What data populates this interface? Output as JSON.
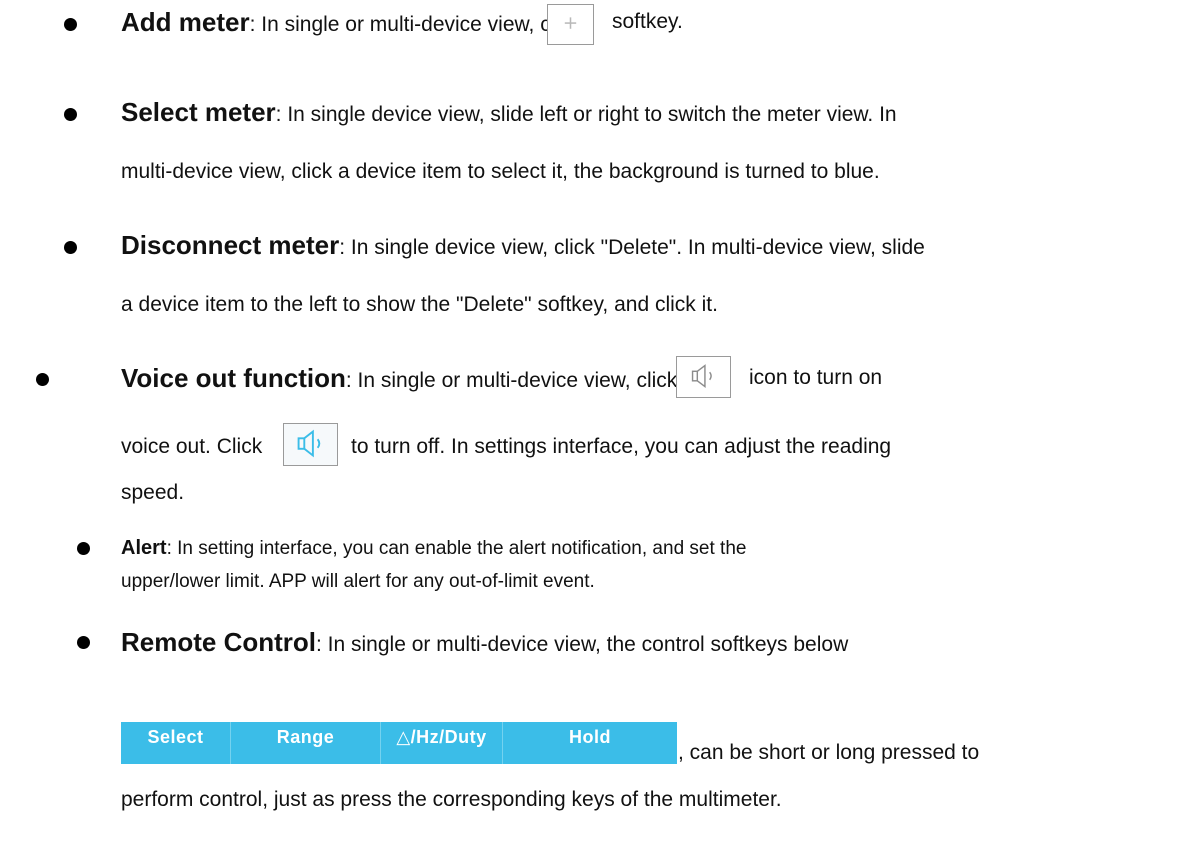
{
  "items": [
    {
      "term": "Add meter",
      "before_icon": ": In single or multi-device view, click",
      "after_icon": "softkey.",
      "icon": "plus-icon"
    },
    {
      "term": "Select meter",
      "line1": ": In single device view, slide left or right to switch the meter view. In",
      "line2": "multi-device view, click a device item to select it, the background is turned to blue."
    },
    {
      "term": "Disconnect meter",
      "line1": ": In single device view, click \"Delete\". In multi-device view, slide",
      "line2": "a device item to the left to show the \"Delete\" softkey, and click it."
    },
    {
      "term": "Voice out function",
      "line1_before": ": In single or multi-device view, click the",
      "line1_after": "icon to turn on",
      "line2_before": "voice out. Click",
      "line2_after": "to turn off. In settings interface, you can adjust the reading",
      "line3": "speed.",
      "icon_off": "speaker-icon",
      "icon_on": "speaker-active-icon",
      "icon_on_color": "#3bbde8"
    },
    {
      "term": "Alert",
      "line1": ": In setting interface, you can enable the alert notification, and set the",
      "line2": "upper/lower limit. APP will alert for any out-of-limit event."
    },
    {
      "term": "Remote Control",
      "line1": ": In single or multi-device view, the control softkeys below",
      "line2_after": ", can be short or long pressed to",
      "line3": "perform control, just as press the corresponding keys of the multimeter."
    }
  ],
  "softkeys": [
    "Select",
    "Range",
    "△/Hz/Duty",
    "Hold"
  ],
  "colors": {
    "softkey_bar": "#3bbde8",
    "softkey_text": "#ffffff"
  }
}
